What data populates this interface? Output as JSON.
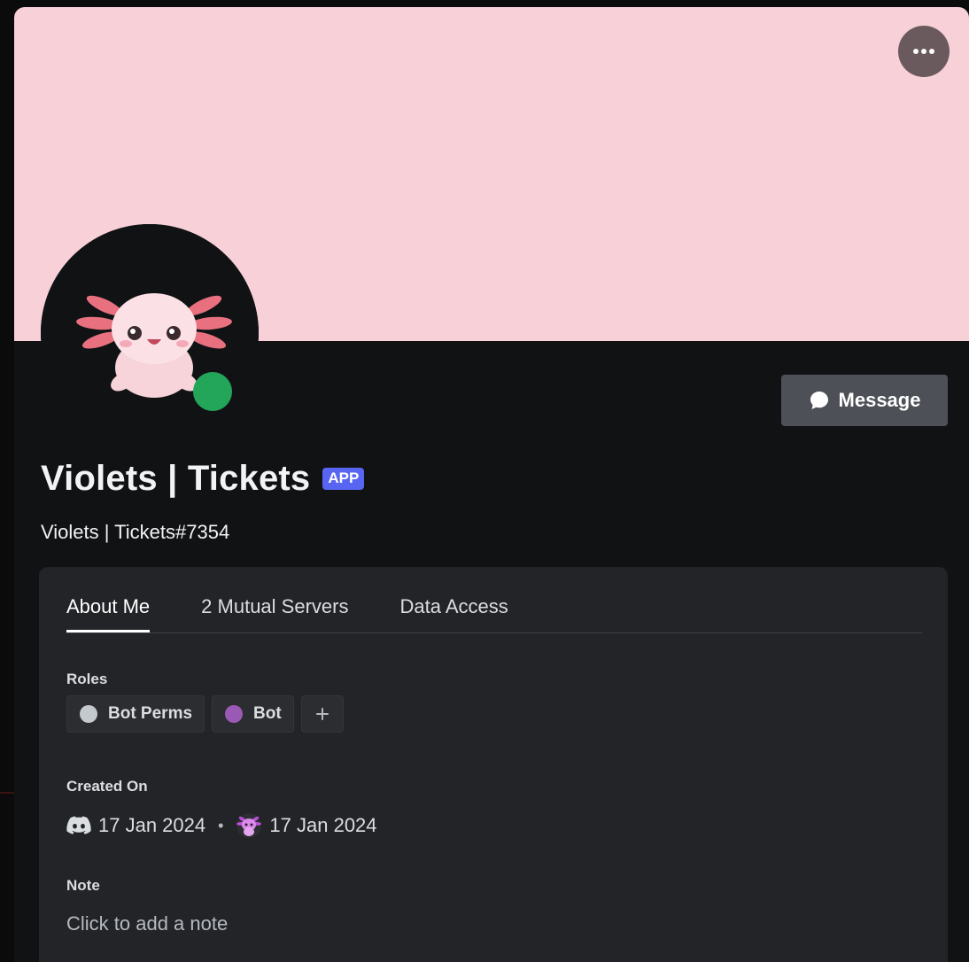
{
  "colors": {
    "banner": "#f8d0d8",
    "status_online": "#23a55a",
    "app_badge": "#5865f2",
    "role_bot_perms": "#c4c9ce",
    "role_bot": "#9b59b6"
  },
  "header": {
    "more_icon": "ellipsis-icon"
  },
  "profile": {
    "display_name": "Violets | Tickets",
    "badge": "APP",
    "username": "Violets | Tickets#7354",
    "status": "online"
  },
  "actions": {
    "message_label": "Message",
    "message_icon": "chat-bubble-icon"
  },
  "tabs": [
    {
      "label": "About Me",
      "active": true
    },
    {
      "label": "2 Mutual Servers",
      "active": false
    },
    {
      "label": "Data Access",
      "active": false
    }
  ],
  "roles": {
    "label": "Roles",
    "items": [
      {
        "name": "Bot Perms",
        "color": "#c4c9ce"
      },
      {
        "name": "Bot",
        "color": "#9b59b6"
      }
    ],
    "add_icon": "plus-icon"
  },
  "created": {
    "label": "Created On",
    "discord_date": "17 Jan 2024",
    "server_date": "17 Jan 2024",
    "separator": "•"
  },
  "note": {
    "label": "Note",
    "placeholder": "Click to add a note"
  }
}
